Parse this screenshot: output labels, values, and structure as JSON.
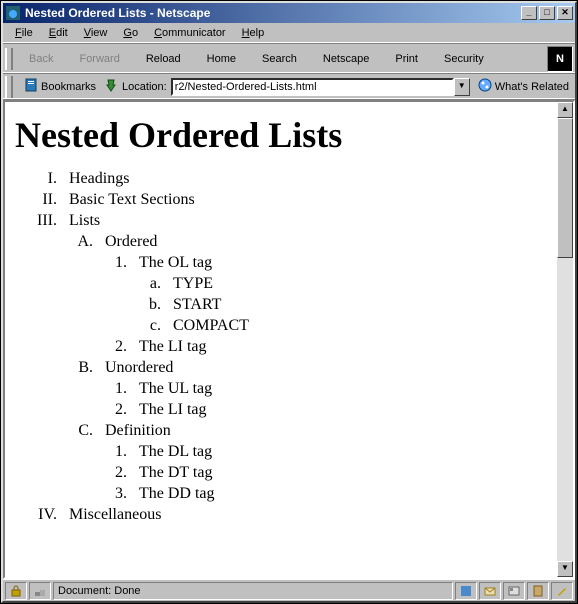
{
  "window": {
    "title": "Nested Ordered Lists - Netscape"
  },
  "menu": {
    "items": [
      "File",
      "Edit",
      "View",
      "Go",
      "Communicator",
      "Help"
    ]
  },
  "toolbar": {
    "back": "Back",
    "forward": "Forward",
    "reload": "Reload",
    "home": "Home",
    "search": "Search",
    "netscape": "Netscape",
    "print": "Print",
    "security": "Security"
  },
  "locbar": {
    "bookmarks": "Bookmarks",
    "location_label": "Location:",
    "location_value": "r2/Nested-Ordered-Lists.html",
    "related": "What's Related"
  },
  "page": {
    "h1": "Nested Ordered Lists"
  },
  "list": {
    "items": [
      {
        "marker": "I.",
        "label": "Headings"
      },
      {
        "marker": "II.",
        "label": "Basic Text Sections"
      },
      {
        "marker": "III.",
        "label": "Lists",
        "children": [
          {
            "marker": "A.",
            "label": "Ordered",
            "children": [
              {
                "marker": "1.",
                "label": "The OL tag",
                "children": [
                  {
                    "marker": "a.",
                    "label": "TYPE"
                  },
                  {
                    "marker": "b.",
                    "label": "START"
                  },
                  {
                    "marker": "c.",
                    "label": "COMPACT"
                  }
                ]
              },
              {
                "marker": "2.",
                "label": "The LI tag"
              }
            ]
          },
          {
            "marker": "B.",
            "label": "Unordered",
            "children": [
              {
                "marker": "1.",
                "label": "The UL tag"
              },
              {
                "marker": "2.",
                "label": "The LI tag"
              }
            ]
          },
          {
            "marker": "C.",
            "label": "Definition",
            "children": [
              {
                "marker": "1.",
                "label": "The DL tag"
              },
              {
                "marker": "2.",
                "label": "The DT tag"
              },
              {
                "marker": "3.",
                "label": "The DD tag"
              }
            ]
          }
        ]
      },
      {
        "marker": "IV.",
        "label": "Miscellaneous"
      }
    ]
  },
  "status": {
    "text": "Document: Done"
  }
}
